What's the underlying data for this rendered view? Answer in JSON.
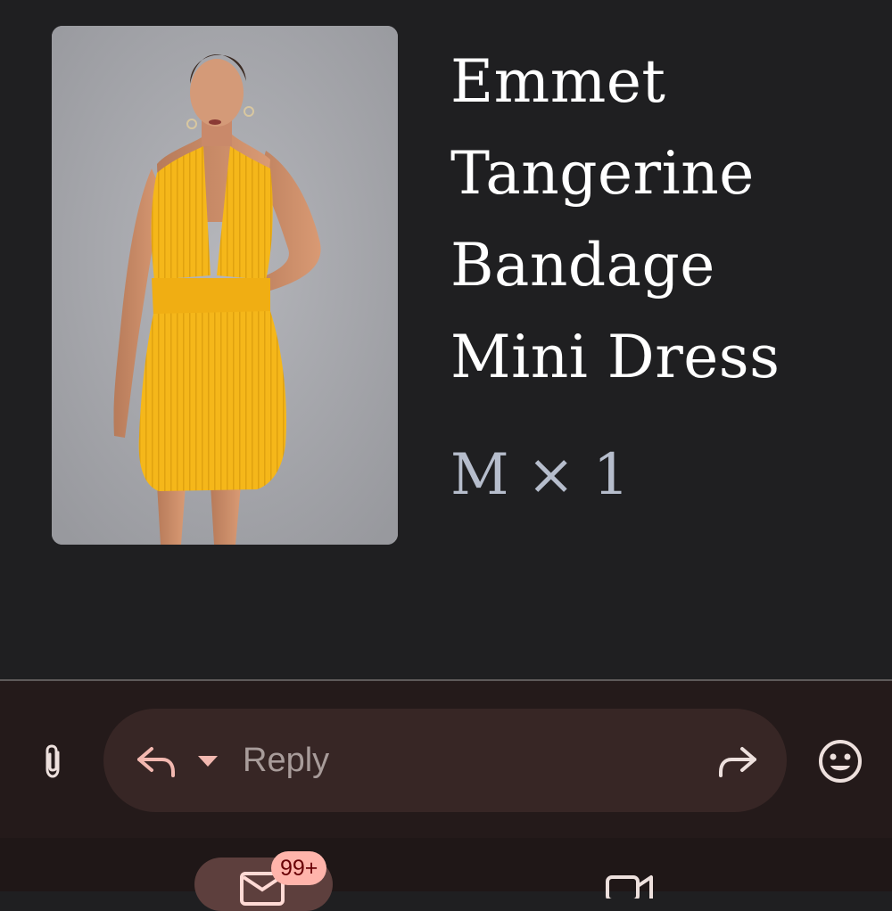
{
  "product": {
    "title": "Emmet Tangerine Bandage Mini Dress",
    "size_quantity": "M × 1",
    "image_alt": "Model wearing yellow halter bandage mini dress"
  },
  "reply_bar": {
    "reply_label": "Reply"
  },
  "bottom_nav": {
    "mail_badge": "99+"
  },
  "colors": {
    "background": "#1f1f21",
    "reply_bar_bg": "#241a1a",
    "pill_bg": "#372625",
    "accent_icon": "#f2b8b0",
    "badge_bg": "#ffb4ab",
    "dress_yellow": "#f5b71a"
  },
  "icons": {
    "attach": "paperclip-icon",
    "reply": "reply-arrow-icon",
    "dropdown": "caret-down-icon",
    "forward": "forward-arrow-icon",
    "emoji": "smiley-icon",
    "mail": "mail-icon",
    "video": "video-icon"
  }
}
